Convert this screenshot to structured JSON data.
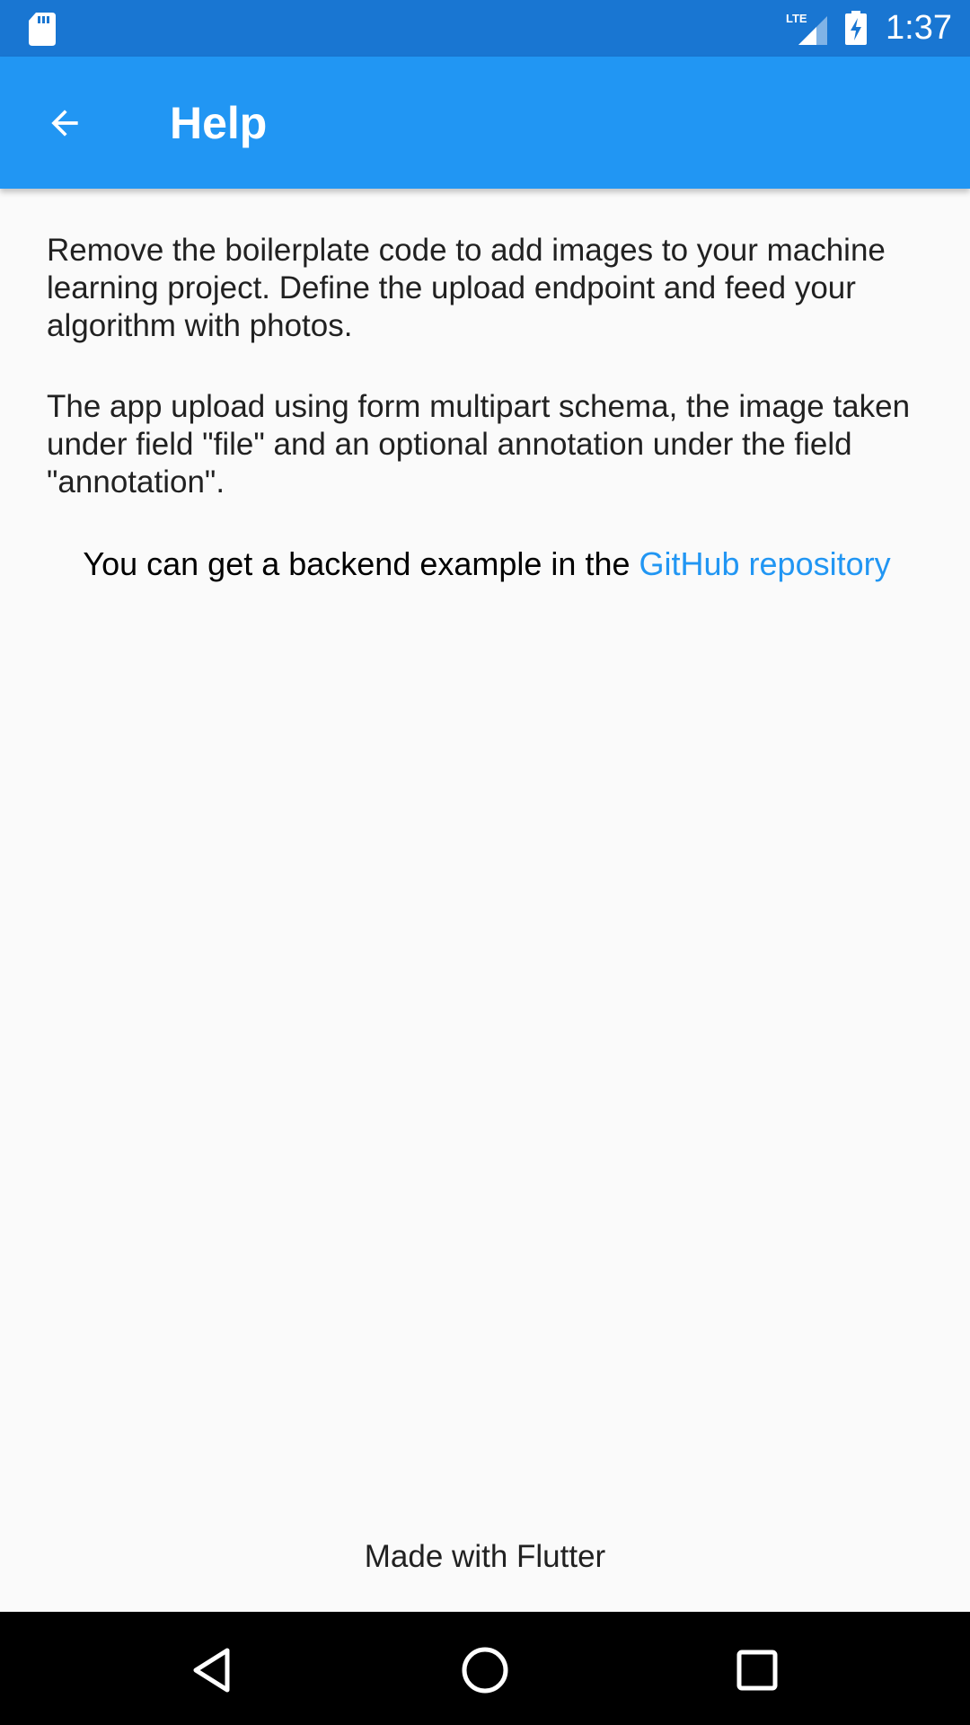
{
  "status_bar": {
    "time": "1:37",
    "network_label": "LTE",
    "icons": [
      "sd-card-icon",
      "lte-signal-icon",
      "battery-charging-icon"
    ]
  },
  "app_bar": {
    "title": "Help",
    "back_icon": "arrow-back-icon"
  },
  "content": {
    "paragraph_1": "Remove the boilerplate code to add images to your machine learning project. Define the upload endpoint and feed your algorithm with photos.",
    "paragraph_2": "The app upload using form multipart schema, the image taken under field \"file\" and an optional annotation under the field \"annotation\".",
    "backend_text": "You can get a backend example in the ",
    "link_text": "GitHub repository"
  },
  "footer": {
    "text": "Made with Flutter"
  },
  "nav_bar": {
    "buttons": [
      "back-triangle-icon",
      "home-circle-icon",
      "recents-square-icon"
    ]
  },
  "colors": {
    "status_bar": "#1976d2",
    "app_bar": "#2196f3",
    "link": "#2196f3",
    "background": "#fafafa",
    "nav_bar": "#000000"
  }
}
